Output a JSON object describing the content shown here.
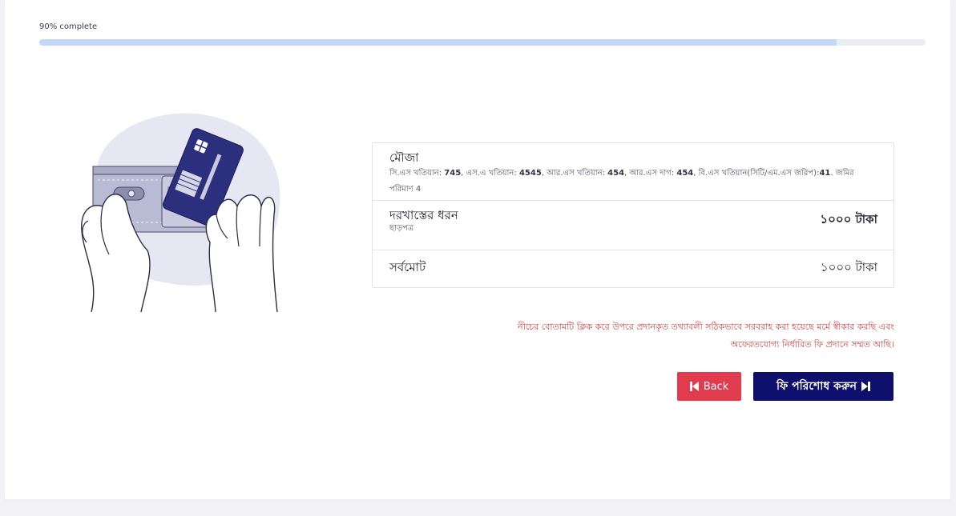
{
  "progress": {
    "label": "90% complete",
    "percent": 90
  },
  "summary": {
    "mouza": {
      "title": "মৌজা",
      "details": [
        {
          "label": "সি.এস খতিয়ান:",
          "value": "745"
        },
        {
          "label": "এস.এ খতিয়ান:",
          "value": "4545"
        },
        {
          "label": "আর.এস খতিয়ান:",
          "value": "454"
        },
        {
          "label": "আর.এস দাগ:",
          "value": "454"
        },
        {
          "label": "বি.এস খতিয়ান(সিটি/এম.এস জরিপ):",
          "value": "41"
        }
      ],
      "land_amount": "জমির পরিমাণ 4"
    },
    "application": {
      "title": "দরখাস্তের ধরন",
      "subtitle": "ছাড়পত্র",
      "amount": "১০০০ টাকা"
    },
    "total": {
      "title": "সর্বমোট",
      "amount": "১০০০ টাকা"
    }
  },
  "notice": {
    "line1": "নীচের বোতামটি ক্লিক করে উপরে প্রদানকৃত তথ্যাবলী সঠিকভাবে সরবরাহ করা হয়েছে মর্মে স্বীকার করছি এবং",
    "line2": "অফেরতযোগ্য নির্ধারিত ফি প্রদানে সম্মত আছি।"
  },
  "buttons": {
    "back_label": "Back",
    "back_icon": "skip-back-icon",
    "pay_label": "ফি পরিশোধ করুন",
    "pay_icon": "skip-forward-icon"
  },
  "illustration": {
    "icon": "wallet-card-payment-illustration"
  },
  "colors": {
    "progress_fill": "#c3d8f7",
    "back_button": "#e23b4d",
    "pay_button": "#0e0f6c",
    "notice_text": "#e23c3c"
  }
}
